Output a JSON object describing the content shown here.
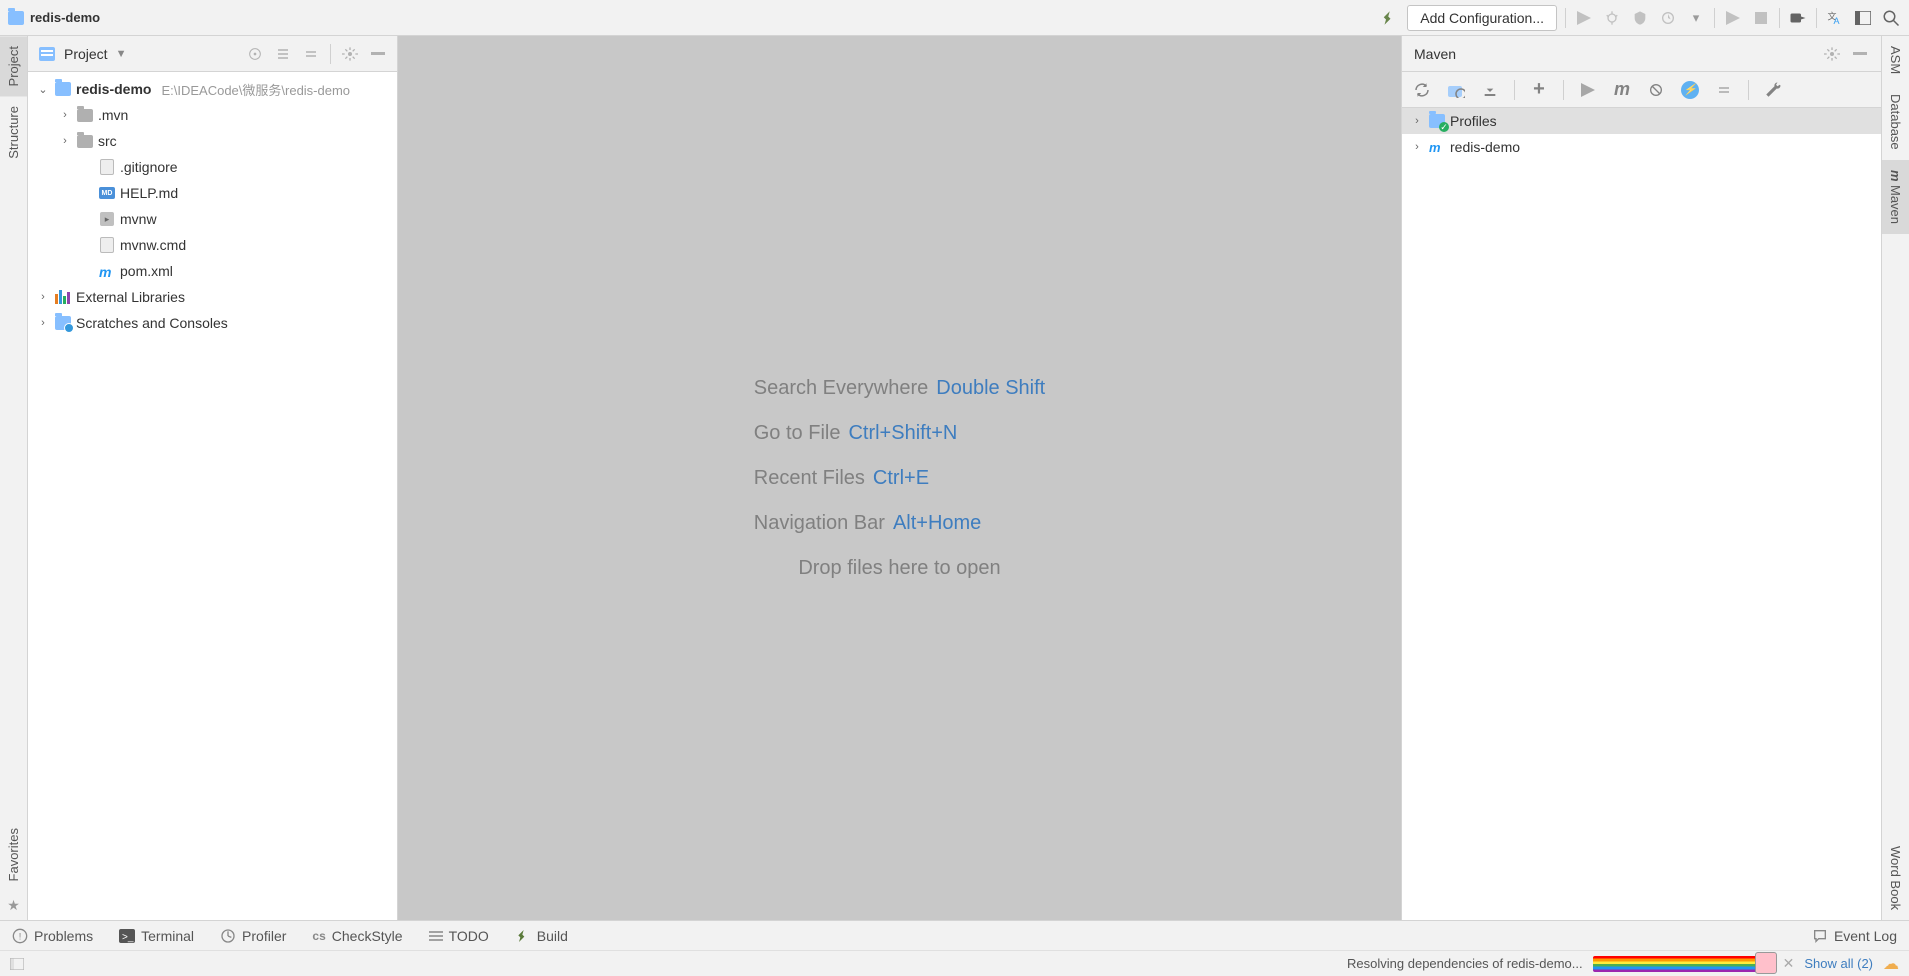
{
  "project_name": "redis-demo",
  "project_path": "E:\\IDEACode\\微服务\\redis-demo",
  "toolbar": {
    "add_config_label": "Add Configuration..."
  },
  "left_rail": {
    "project": "Project",
    "structure": "Structure",
    "favorites": "Favorites"
  },
  "project_panel": {
    "title": "Project",
    "tree": {
      "root": "redis-demo",
      "mvn": ".mvn",
      "src": "src",
      "gitignore": ".gitignore",
      "help": "HELP.md",
      "mvnw": "mvnw",
      "mvnwcmd": "mvnw.cmd",
      "pom": "pom.xml",
      "ext_libs": "External Libraries",
      "scratches": "Scratches and Consoles"
    }
  },
  "editor_hints": {
    "search": "Search Everywhere",
    "search_key": "Double Shift",
    "goto": "Go to File",
    "goto_key": "Ctrl+Shift+N",
    "recent": "Recent Files",
    "recent_key": "Ctrl+E",
    "navbar": "Navigation Bar",
    "navbar_key": "Alt+Home",
    "drop": "Drop files here to open"
  },
  "maven": {
    "title": "Maven",
    "profiles": "Profiles",
    "project": "redis-demo"
  },
  "right_rail": {
    "asm": "ASM",
    "database": "Database",
    "maven": "Maven",
    "wordbook": "Word Book"
  },
  "bottom": {
    "problems": "Problems",
    "terminal": "Terminal",
    "profiler": "Profiler",
    "checkstyle": "CheckStyle",
    "todo": "TODO",
    "build": "Build",
    "event_log": "Event Log"
  },
  "status": {
    "message": "Resolving dependencies of redis-demo...",
    "show_all": "Show all (2)"
  }
}
